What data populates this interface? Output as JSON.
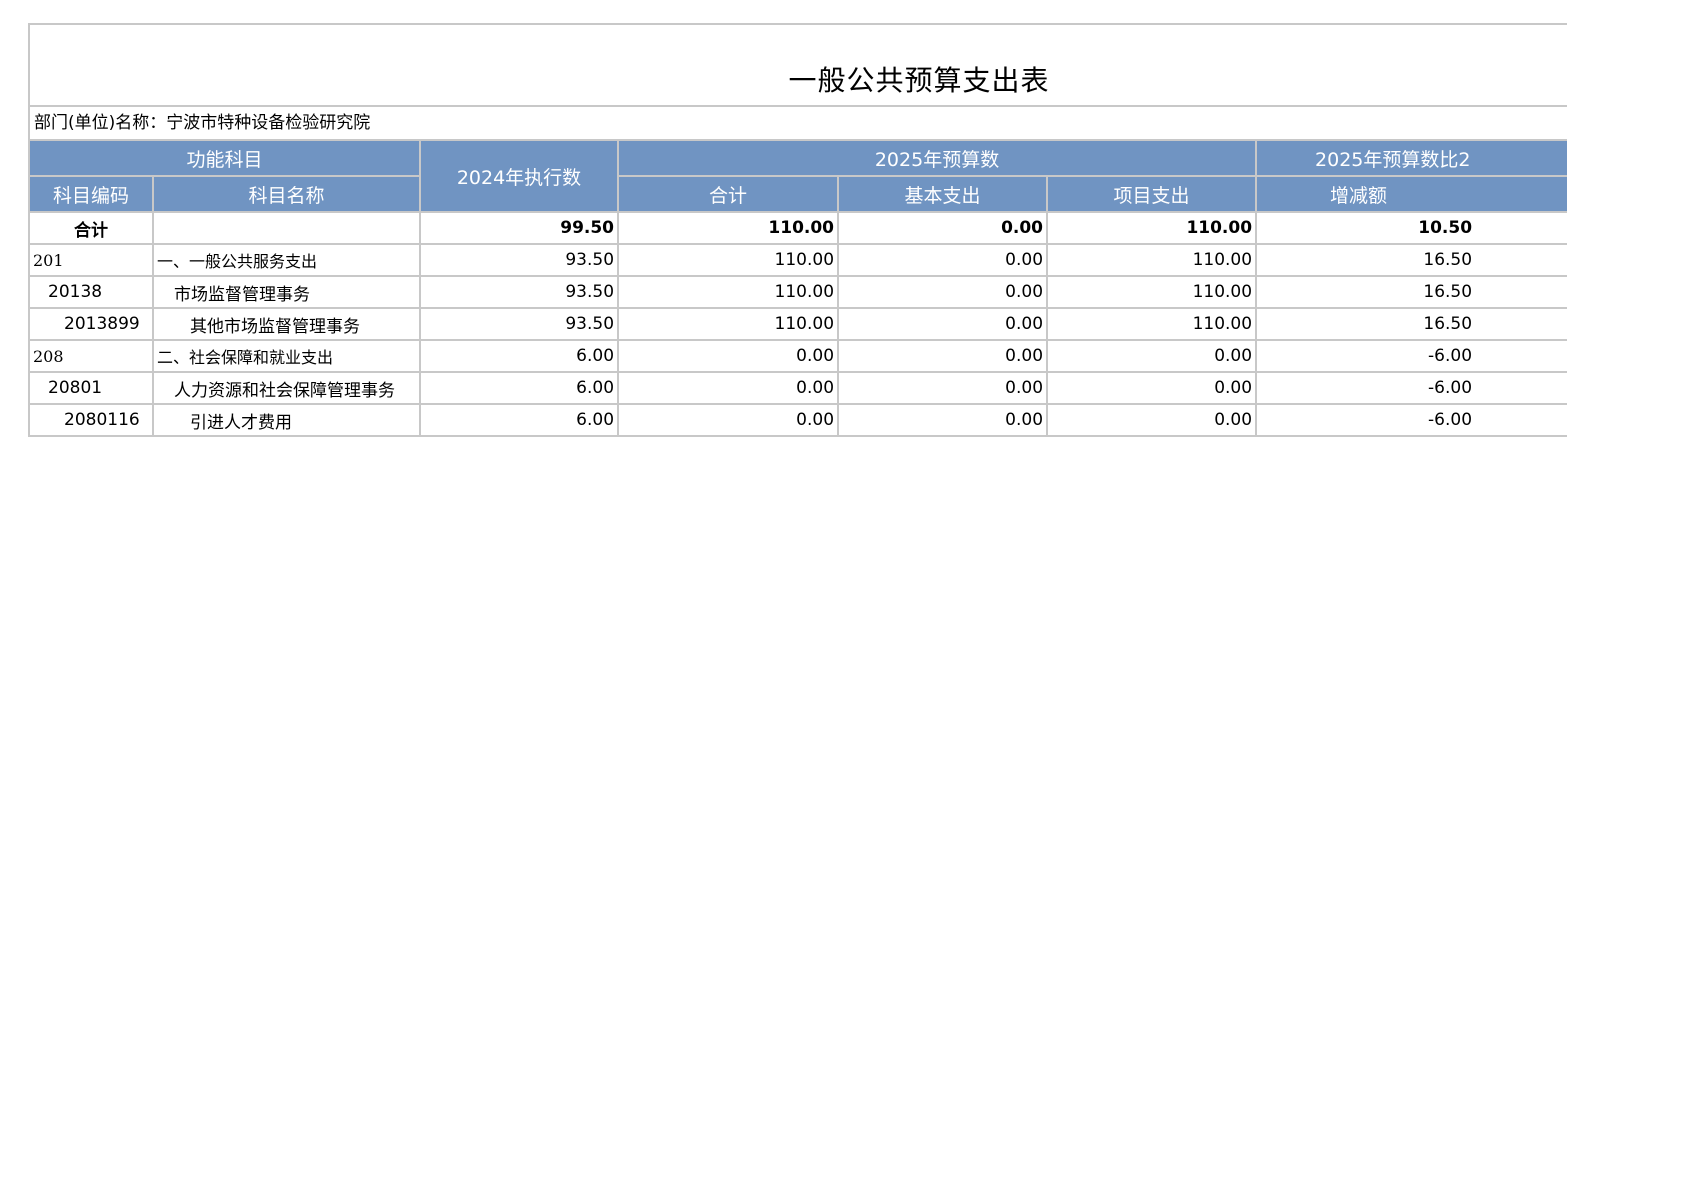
{
  "title": "一般公共预算支出表",
  "department": "部门(单位)名称：宁波市特种设备检验研究院",
  "headers": {
    "function_subject": "功能科目",
    "exec_2024": "2024年执行数",
    "budget_2025": "2025年预算数",
    "compare": "2025年预算数比2",
    "code": "科目编码",
    "name": "科目名称",
    "total": "合计",
    "basic": "基本支出",
    "project": "项目支出",
    "change": "增减额"
  },
  "rows": [
    {
      "code": "合计",
      "name": "",
      "exec": "99.50",
      "total": "110.00",
      "basic": "0.00",
      "project": "110.00",
      "change": "10.50"
    },
    {
      "code": "201",
      "name": "一、一般公共服务支出",
      "exec": "93.50",
      "total": "110.00",
      "basic": "0.00",
      "project": "110.00",
      "change": "16.50"
    },
    {
      "code": "20138",
      "name": "市场监督管理事务",
      "exec": "93.50",
      "total": "110.00",
      "basic": "0.00",
      "project": "110.00",
      "change": "16.50"
    },
    {
      "code": "2013899",
      "name": "其他市场监督管理事务",
      "exec": "93.50",
      "total": "110.00",
      "basic": "0.00",
      "project": "110.00",
      "change": "16.50"
    },
    {
      "code": "208",
      "name": "二、社会保障和就业支出",
      "exec": "6.00",
      "total": "0.00",
      "basic": "0.00",
      "project": "0.00",
      "change": "-6.00"
    },
    {
      "code": "20801",
      "name": "人力资源和社会保障管理事务",
      "exec": "6.00",
      "total": "0.00",
      "basic": "0.00",
      "project": "0.00",
      "change": "-6.00"
    },
    {
      "code": "2080116",
      "name": "引进人才费用",
      "exec": "6.00",
      "total": "0.00",
      "basic": "0.00",
      "project": "0.00",
      "change": "-6.00"
    }
  ]
}
